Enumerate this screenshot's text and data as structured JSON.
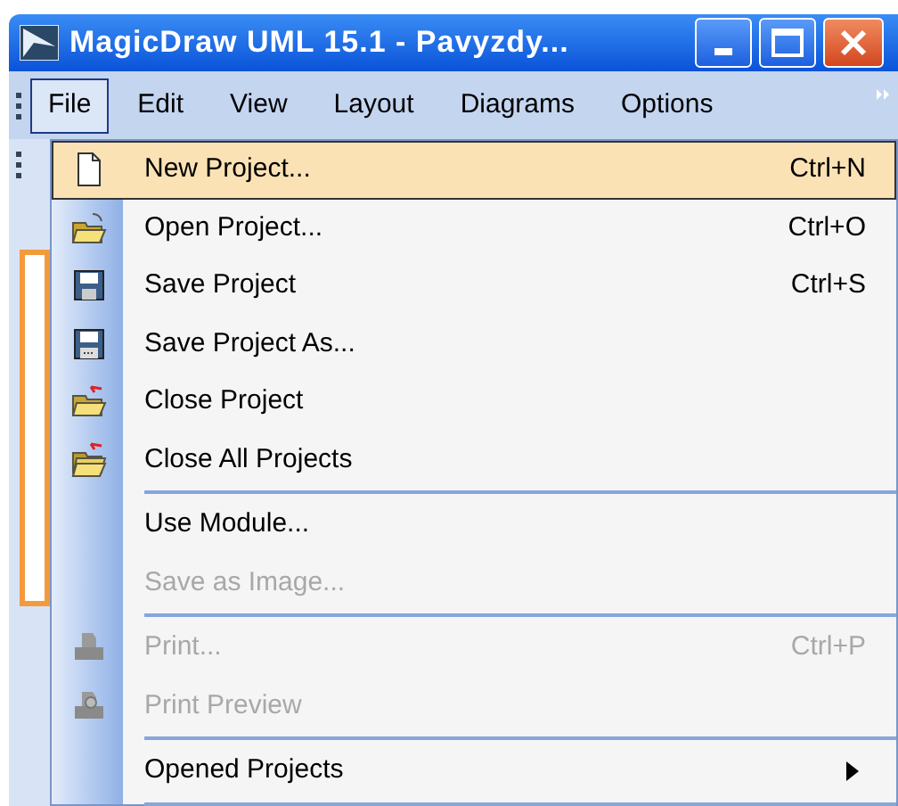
{
  "window": {
    "title": "MagicDraw UML 15.1 - Pavyzdy..."
  },
  "menu_bar": [
    {
      "label": "File",
      "selected": true
    },
    {
      "label": "Edit",
      "selected": false
    },
    {
      "label": "View",
      "selected": false
    },
    {
      "label": "Layout",
      "selected": false
    },
    {
      "label": "Diagrams",
      "selected": false
    },
    {
      "label": "Options",
      "selected": false
    }
  ],
  "file_menu": [
    {
      "kind": "item",
      "label": "New Project...",
      "shortcut": "Ctrl+N",
      "selected": true,
      "disabled": false
    },
    {
      "kind": "item",
      "label": "Open Project...",
      "shortcut": "Ctrl+O",
      "selected": false,
      "disabled": false
    },
    {
      "kind": "item",
      "label": "Save Project",
      "shortcut": "Ctrl+S",
      "selected": false,
      "disabled": false
    },
    {
      "kind": "item",
      "label": "Save Project As...",
      "selected": false,
      "disabled": false
    },
    {
      "kind": "item",
      "label": "Close Project",
      "selected": false,
      "disabled": false
    },
    {
      "kind": "item",
      "label": "Close All Projects",
      "selected": false,
      "disabled": false
    },
    {
      "kind": "separator"
    },
    {
      "kind": "item",
      "label": "Use Module...",
      "selected": false,
      "disabled": false
    },
    {
      "kind": "item",
      "label": "Save as Image...",
      "selected": false,
      "disabled": true
    },
    {
      "kind": "separator"
    },
    {
      "kind": "item",
      "label": "Print...",
      "shortcut": "Ctrl+P",
      "selected": false,
      "disabled": true
    },
    {
      "kind": "item",
      "label": "Print Preview",
      "selected": false,
      "disabled": true
    },
    {
      "kind": "separator"
    },
    {
      "kind": "item",
      "label": "Opened Projects",
      "selected": false,
      "disabled": false,
      "submenu": true
    },
    {
      "kind": "separator"
    }
  ]
}
